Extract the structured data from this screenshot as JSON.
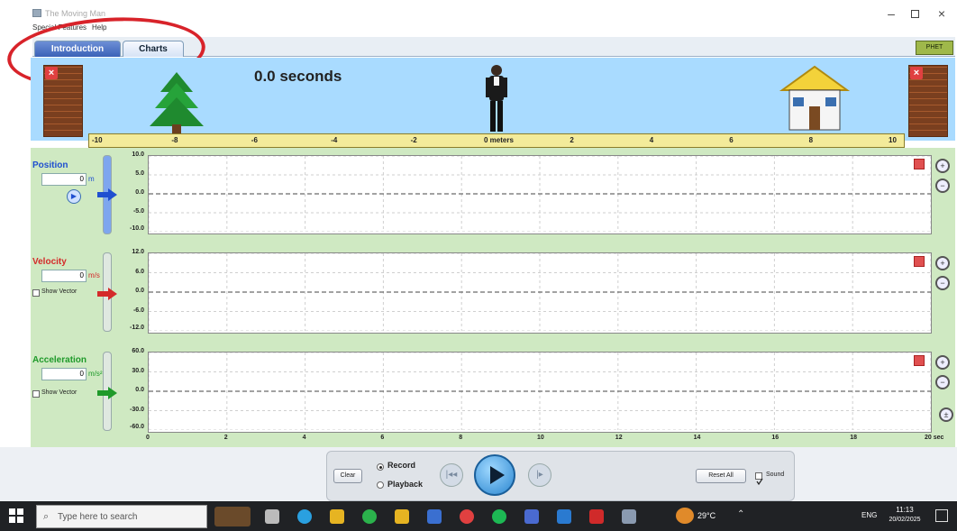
{
  "window": {
    "title": "The Moving Man",
    "menu": [
      "Special Features",
      "Help"
    ],
    "minimize_glyph": "–",
    "maximize_glyph": "ð",
    "close_glyph": "×"
  },
  "tabs": [
    {
      "label": "Introduction",
      "selected": true
    },
    {
      "label": "Charts",
      "selected": false
    }
  ],
  "corner_button_label": "PHET",
  "scene": {
    "time_text": "0.0 seconds",
    "ruler_ticks": [
      "-10",
      "-8",
      "-6",
      "-4",
      "-2",
      "0 meters",
      "2",
      "4",
      "6",
      "8",
      "10"
    ],
    "wall_close_glyph": "×"
  },
  "panels": {
    "position": {
      "label": "Position",
      "value": "0",
      "unit": "m",
      "color": "#1f4fd0",
      "ticks": [
        "10.0",
        "5.0",
        "0.0",
        "-5.0",
        "-10.0"
      ]
    },
    "velocity": {
      "label": "Velocity",
      "value": "0",
      "unit": "m/s",
      "color": "#d42a2a",
      "show_vector": "Show Vector",
      "ticks": [
        "12.0",
        "6.0",
        "0.0",
        "-6.0",
        "-12.0"
      ]
    },
    "acceleration": {
      "label": "Acceleration",
      "value": "0",
      "unit": "m/s²",
      "color": "#1f9a2a",
      "show_vector": "Show Vector",
      "ticks": [
        "60.0",
        "30.0",
        "0.0",
        "-30.0",
        "-60.0"
      ]
    }
  },
  "time_axis": {
    "ticks": [
      "0",
      "2",
      "4",
      "6",
      "8",
      "10",
      "12",
      "14",
      "16",
      "18",
      "20 sec"
    ]
  },
  "chart_data": [
    {
      "type": "line",
      "ylabel": "Position",
      "ylim": [
        -10,
        10
      ],
      "xlim": [
        0,
        20
      ],
      "grid": true,
      "series": []
    },
    {
      "type": "line",
      "ylabel": "Velocity",
      "ylim": [
        -12,
        12
      ],
      "xlim": [
        0,
        20
      ],
      "grid": true,
      "series": []
    },
    {
      "type": "line",
      "ylabel": "Acceleration",
      "ylim": [
        -60,
        60
      ],
      "xlim": [
        0,
        20
      ],
      "grid": true,
      "series": []
    }
  ],
  "controls": {
    "clear_label": "Clear",
    "record_label": "Record",
    "playback_label": "Playback",
    "mode": "Record",
    "reset_label": "Reset All",
    "sound_label": "Sound",
    "sound_checked": true
  },
  "taskbar": {
    "search_placeholder": "Type here to search",
    "temperature": "29°C",
    "language": "ENG",
    "time": "11:13",
    "date": "20/02/2025"
  }
}
